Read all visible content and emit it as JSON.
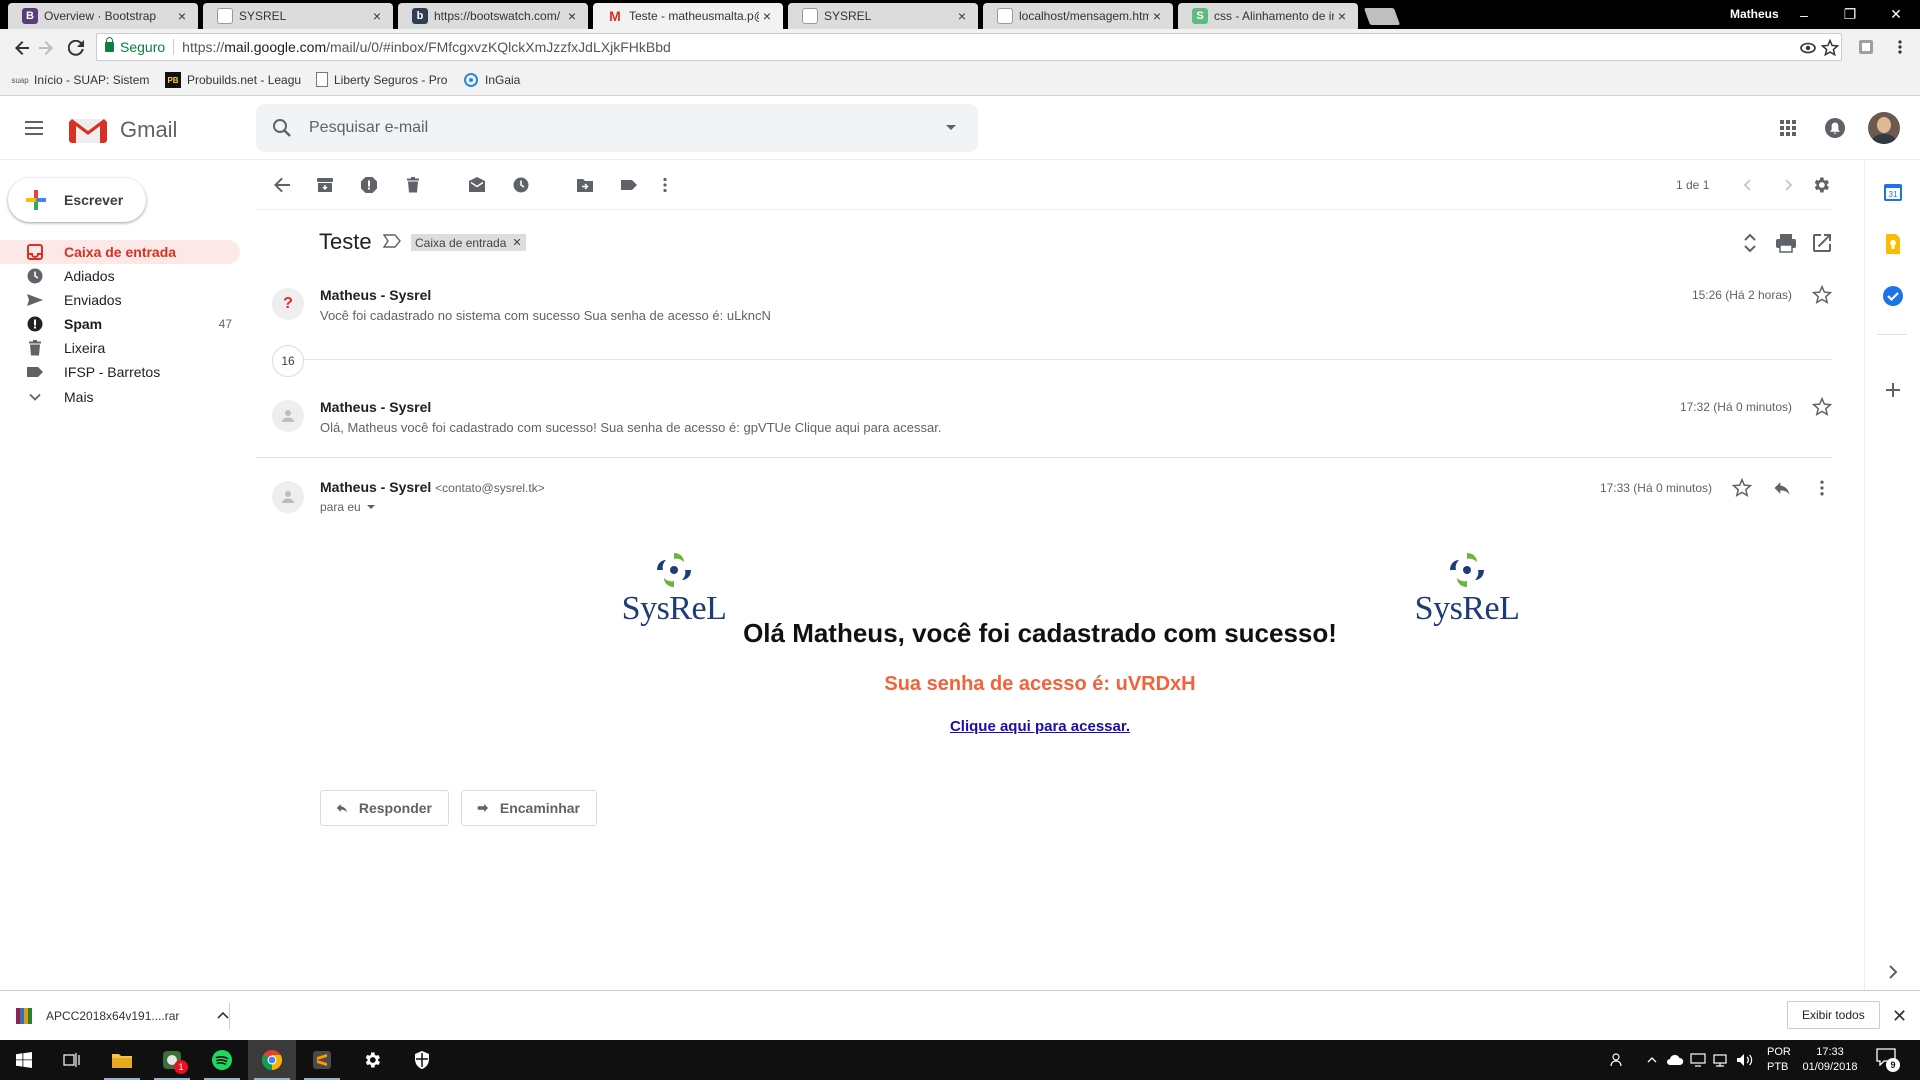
{
  "browser": {
    "tabs": [
      {
        "title": "Overview · Bootstrap",
        "icon": "bootstrap-icon",
        "color": "#563d7c",
        "glyph": "B"
      },
      {
        "title": "SYSREL",
        "icon": "page-icon",
        "color": "#ffffff",
        "glyph": ""
      },
      {
        "title": "https://bootswatch.com/",
        "icon": "bootswatch-icon",
        "color": "#2c3e50",
        "glyph": "b"
      },
      {
        "title": "Teste - matheusmalta.p@",
        "icon": "gmail-icon",
        "color": "#ffffff",
        "glyph": "M"
      },
      {
        "title": "SYSREL",
        "icon": "page-icon",
        "color": "#ffffff",
        "glyph": ""
      },
      {
        "title": "localhost/mensagem.htm",
        "icon": "page-icon",
        "color": "#ffffff",
        "glyph": ""
      },
      {
        "title": "css - Alinhamento de ima",
        "icon": "stackoverflow-icon",
        "color": "#5eba7d",
        "glyph": "S"
      }
    ],
    "active_tab": 3,
    "profile_name": "Matheus",
    "security_label": "Seguro",
    "url_prefix": "https://",
    "url_host": "mail.google.com",
    "url_path": "/mail/u/0/#inbox/FMfcgxvzKQlckXmJzzfxJdLXjkFHkBbd",
    "bookmarks": [
      {
        "label": "Início - SUAP: Sistem",
        "icon": "suap-icon"
      },
      {
        "label": "Probuilds.net - Leagu",
        "icon": "probuilds-icon"
      },
      {
        "label": "Liberty Seguros - Pro",
        "icon": "page-icon"
      },
      {
        "label": "InGaia",
        "icon": "ingaia-icon"
      }
    ]
  },
  "gmail": {
    "app_name": "Gmail",
    "search_placeholder": "Pesquisar e-mail",
    "compose_label": "Escrever",
    "nav": [
      {
        "label": "Caixa de entrada",
        "icon": "inbox-icon",
        "count": "",
        "active": true
      },
      {
        "label": "Adiados",
        "icon": "clock-icon",
        "count": ""
      },
      {
        "label": "Enviados",
        "icon": "send-icon",
        "count": ""
      },
      {
        "label": "Spam",
        "icon": "spam-icon",
        "count": "47",
        "bold": true
      },
      {
        "label": "Lixeira",
        "icon": "trash-icon",
        "count": ""
      },
      {
        "label": "IFSP - Barretos",
        "icon": "label-icon",
        "count": ""
      },
      {
        "label": "Mais",
        "icon": "chevron-down-icon",
        "count": ""
      }
    ],
    "pager": "1 de 1",
    "subject": "Teste",
    "label_chip": "Caixa de entrada",
    "messages": [
      {
        "from": "Matheus - Sysrel",
        "snippet": "Você foi cadastrado no sistema com sucesso Sua senha de acesso é: uLkncN",
        "time": "15:26 (Há 2 horas)"
      },
      {
        "from": "Matheus - Sysrel",
        "snippet": "Olá, Matheus você foi cadastrado com sucesso! Sua senha de acesso é: gpVTUe Clique aqui para acessar.",
        "time": "17:32 (Há 0 minutos)"
      },
      {
        "from": "Matheus - Sysrel",
        "email": "<contato@sysrel.tk>",
        "to": "para eu",
        "time": "17:33 (Há 0 minutos)"
      }
    ],
    "collapsed_count": "16",
    "email_body": {
      "logo_text": "SysReL",
      "heading": "Olá Matheus, você foi cadastrado com sucesso!",
      "password_line": "Sua senha de acesso é: uVRDxH",
      "link_text": "Clique aqui para acessar."
    },
    "reply_label": "Responder",
    "forward_label": "Encaminhar"
  },
  "download_bar": {
    "file": "APCC2018x64v191....rar",
    "show_all": "Exibir todos"
  },
  "taskbar": {
    "lang_top": "POR",
    "lang_bottom": "PTB",
    "time": "17:33",
    "date": "01/09/2018",
    "notification_count": "9",
    "app_badge": "1"
  },
  "colors": {
    "gmail_red": "#d93025",
    "accent_blue": "#1a73e8",
    "password_orange": "#f4623a",
    "link_blue": "#1a0dab"
  }
}
